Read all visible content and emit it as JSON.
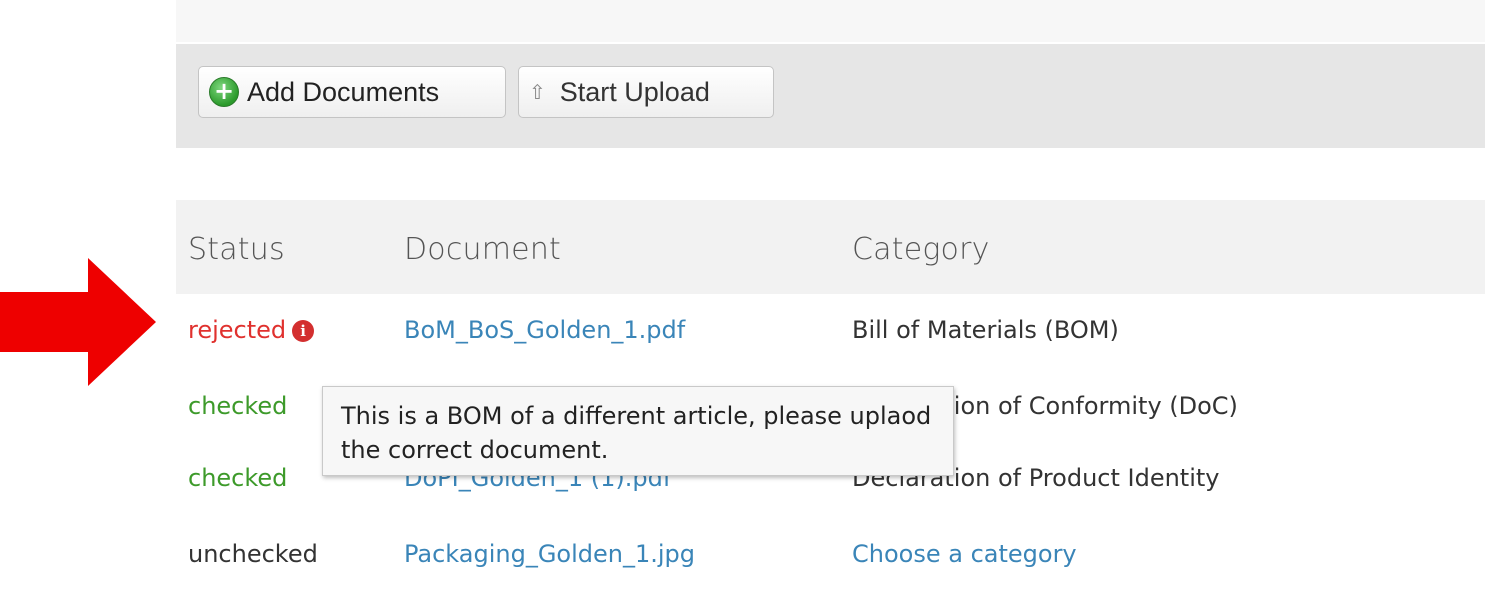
{
  "toolbar": {
    "add_label": "Add Documents",
    "upload_label": "Start Upload"
  },
  "table": {
    "headers": {
      "status": "Status",
      "document": "Document",
      "category": "Category"
    },
    "rows": [
      {
        "status": "rejected",
        "document": "BoM_BoS_Golden_1.pdf",
        "category": "Bill of Materials (BOM)"
      },
      {
        "status": "checked",
        "document": "",
        "category": "Declaration of Conformity (DoC)"
      },
      {
        "status": "checked",
        "document": "DoPI_Golden_1 (1).pdf",
        "category": "Declaration of Product Identity"
      },
      {
        "status": "unchecked",
        "document": "Packaging_Golden_1.jpg",
        "category": "Choose a category"
      }
    ]
  },
  "tooltip": {
    "text": "This is a BOM of a different article, please uplaod the correct document."
  },
  "icons": {
    "add": "plus-circle-icon",
    "upload": "arrow-up-icon",
    "info": "info-circle-icon",
    "annotation": "right-arrow-icon"
  },
  "colors": {
    "rejected": "#e0312e",
    "checked": "#3d9a2a",
    "link": "#3a85b8",
    "annotation_arrow": "#ee0000"
  }
}
